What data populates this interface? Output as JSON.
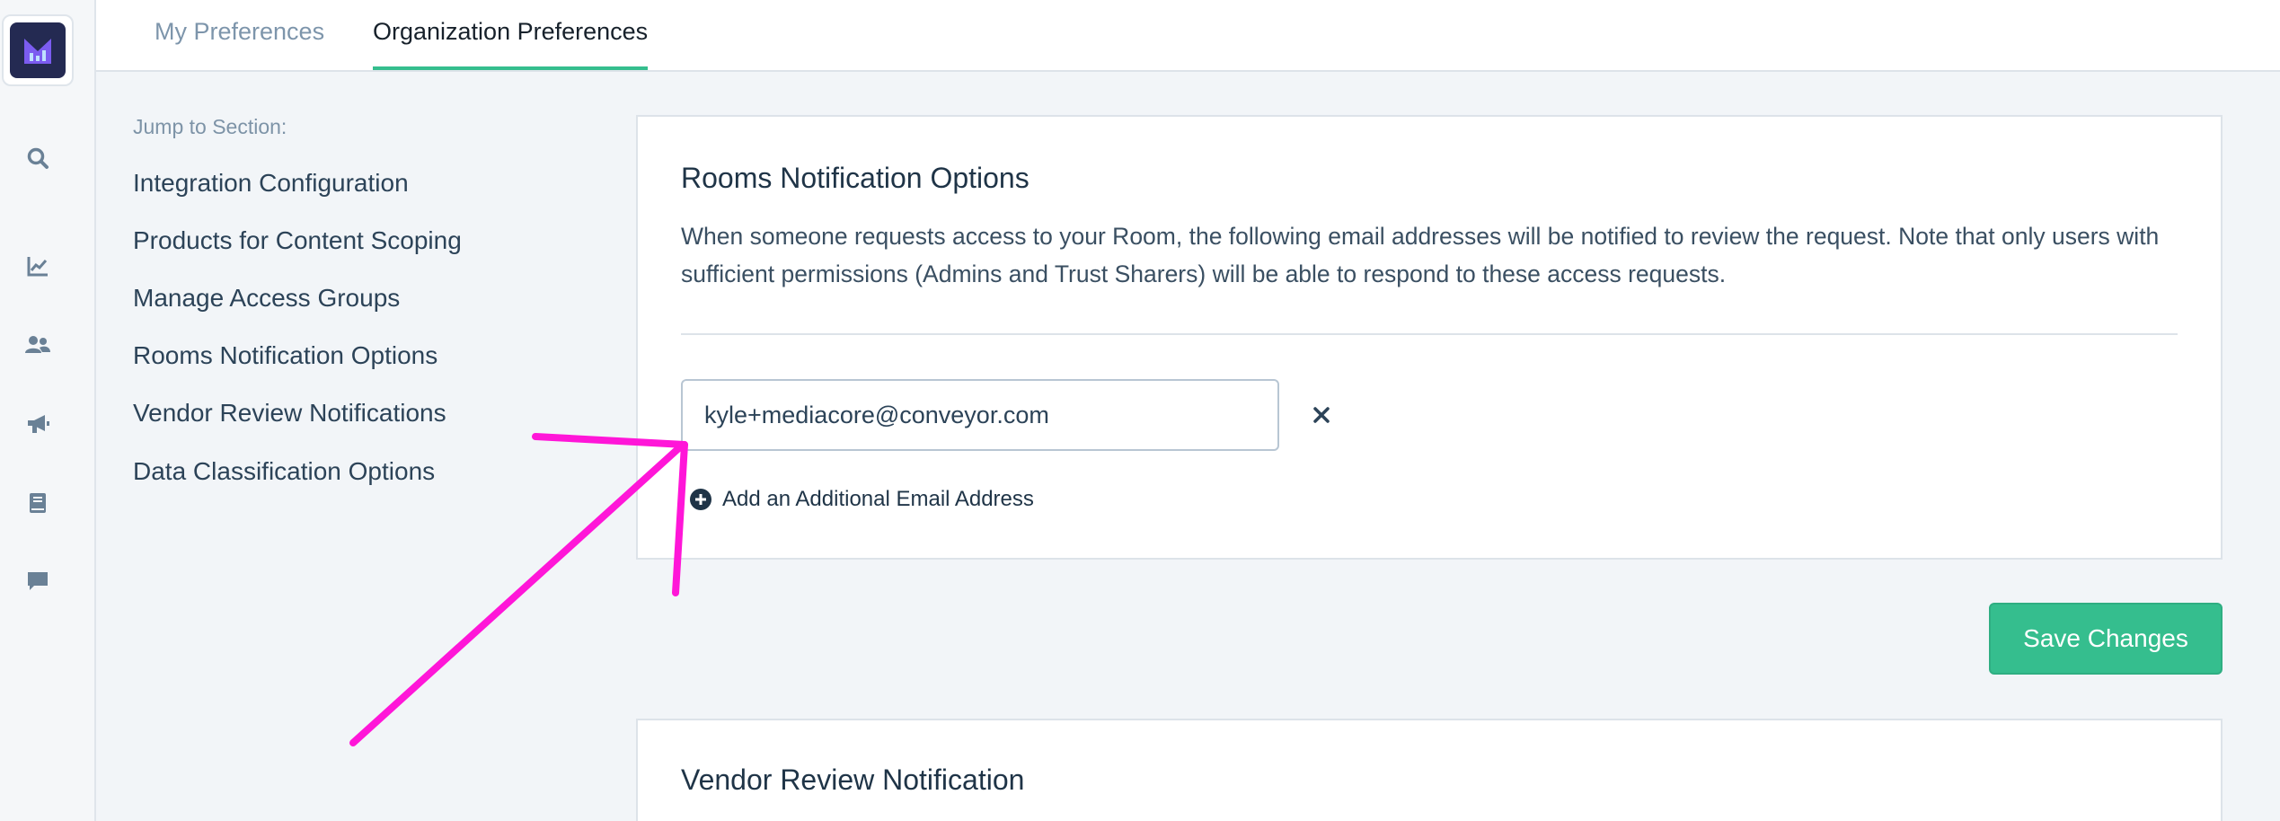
{
  "tabs": {
    "my_preferences": "My Preferences",
    "organization_preferences": "Organization Preferences"
  },
  "rail": {
    "icons": [
      "app-logo-icon",
      "search-icon",
      "chart-icon",
      "users-icon",
      "megaphone-icon",
      "book-icon",
      "chat-icon"
    ]
  },
  "jump": {
    "title": "Jump to Section:",
    "links": [
      "Integration Configuration",
      "Products for Content Scoping",
      "Manage Access Groups",
      "Rooms Notification Options",
      "Vendor Review Notifications",
      "Data Classification Options"
    ]
  },
  "rooms": {
    "title": "Rooms Notification Options",
    "description": "When someone requests access to your Room, the following email addresses will be notified to review the request. Note that only users with sufficient permissions (Admins and Trust Sharers) will be able to respond to these access requests.",
    "email_value": "kyle+mediacore@conveyor.com",
    "add_email_label": "Add an Additional Email Address"
  },
  "save_button": "Save Changes",
  "vendor": {
    "title": "Vendor Review Notification"
  },
  "colors": {
    "accent": "#35be8e",
    "annotation": "#ff16d8",
    "logo_bg": "#242a52"
  }
}
